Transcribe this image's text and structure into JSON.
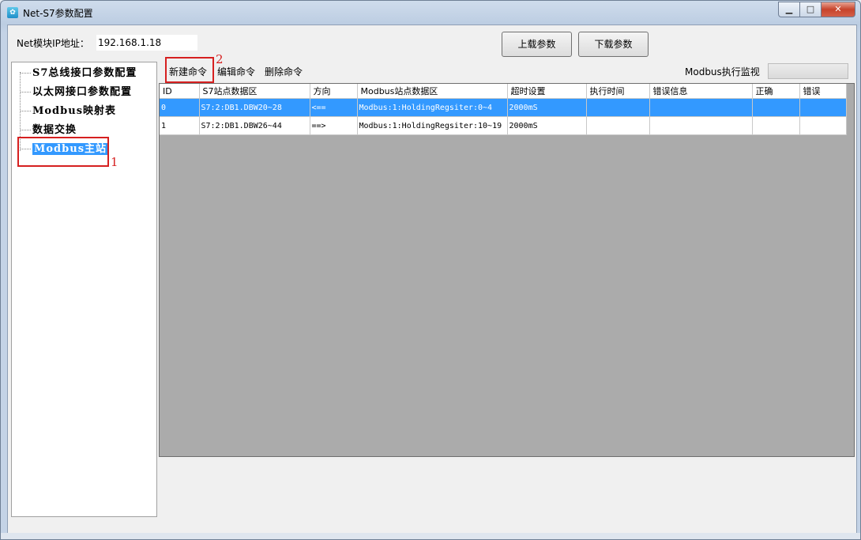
{
  "window": {
    "title": "Net-S7参数配置",
    "icon": "gear-icon",
    "controls": {
      "minimize": "▁",
      "maximize": "□",
      "close": "✕"
    }
  },
  "header": {
    "ip_label": "Net模块IP地址：",
    "ip_value": "192.168.1.18",
    "upload_label": "上载参数",
    "download_label": "下载参数"
  },
  "sidebar": {
    "items": [
      {
        "label": "S7总线接口参数配置"
      },
      {
        "label": "以太网接口参数配置"
      },
      {
        "label": "Modbus映射表"
      },
      {
        "label": "数据交换"
      },
      {
        "label": "Modbus主站",
        "selected": true
      }
    ]
  },
  "toolbar": {
    "new_label": "新建命令",
    "edit_label": "编辑命令",
    "delete_label": "删除命令",
    "monitor_label": "Modbus执行监视"
  },
  "annotations": {
    "one": "1",
    "two": "2"
  },
  "table": {
    "columns": [
      "ID",
      "S7站点数据区",
      "方向",
      "Modbus站点数据区",
      "超时设置",
      "执行时间",
      "错误信息",
      "正确",
      "错误"
    ],
    "rows": [
      {
        "id": "0",
        "s7": "S7:2:DB1.DBW20~28",
        "dir": "<==",
        "modbus": "Modbus:1:HoldingRegsiter:0~4",
        "timeout": "2000mS",
        "exec": "",
        "errinfo": "",
        "ok": "",
        "err": ""
      },
      {
        "id": "1",
        "s7": "S7:2:DB1.DBW26~44",
        "dir": "==>",
        "modbus": "Modbus:1:HoldingRegsiter:10~19",
        "timeout": "2000mS",
        "exec": "",
        "errinfo": "",
        "ok": "",
        "err": ""
      }
    ]
  },
  "colors": {
    "selection": "#3399ff",
    "annotation": "#d62020",
    "grid_background": "#ababab"
  }
}
